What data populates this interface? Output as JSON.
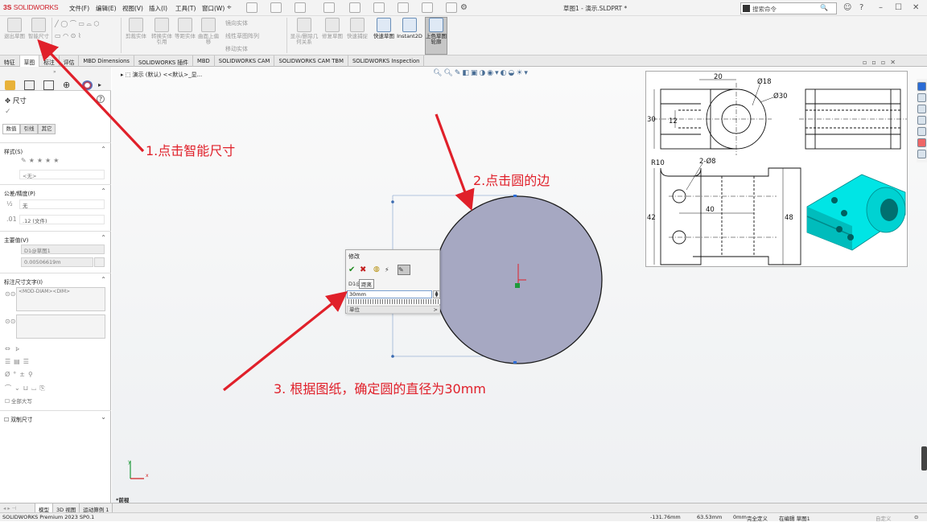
{
  "app": {
    "logo_ds": "3S",
    "logo_name": "SOLIDWORKS",
    "doc_title": "草图1 - 演示.SLDPRT *"
  },
  "menu": [
    "文件(F)",
    "编辑(E)",
    "视图(V)",
    "插入(I)",
    "工具(T)",
    "窗口(W)"
  ],
  "search": {
    "placeholder": "搜索命令"
  },
  "commands": [
    {
      "label": "退出草图",
      "enabled": false
    },
    {
      "label": "智能尺寸",
      "enabled": false
    },
    {
      "label": "剪裁实体",
      "enabled": false
    },
    {
      "label": "转换实体引用",
      "enabled": false
    },
    {
      "label": "等距实体",
      "enabled": false
    },
    {
      "label": "曲面上偏移",
      "enabled": false
    },
    {
      "label": "镜向实体",
      "enabled": false
    },
    {
      "label": "线性草图阵列",
      "enabled": false
    },
    {
      "label": "移动实体",
      "enabled": false
    },
    {
      "label": "显示/删除几何关系",
      "enabled": false
    },
    {
      "label": "修复草图",
      "enabled": false
    },
    {
      "label": "快速捕捉",
      "enabled": false
    },
    {
      "label": "快速草图",
      "enabled": true
    },
    {
      "label": "Instant2D",
      "enabled": true
    },
    {
      "label": "上色草图轮廓",
      "enabled": true
    }
  ],
  "tabs": [
    "特征",
    "草图",
    "标注",
    "评估",
    "MBD Dimensions",
    "SOLIDWORKS 插件",
    "MBD",
    "SOLIDWORKS CAM",
    "SOLIDWORKS CAM TBM",
    "SOLIDWORKS Inspection"
  ],
  "panel": {
    "title": "尺寸",
    "subtabs": [
      "数值",
      "引线",
      "其它"
    ],
    "style_label": "样式(S)",
    "style_value": "<无>",
    "tolerance_label": "公差/精度(P)",
    "tolerance_type": "无",
    "precision": ".12 (文件)",
    "primary_label": "主要值(V)",
    "primary_name": "D1@草图1",
    "primary_value": "0.00506619m",
    "dimtext_label": "标注尺寸文字(I)",
    "dimtext_value": "<MOD-DIAM><DIM>",
    "fullsize_label": "全部大写",
    "dual_label": "双制尺寸"
  },
  "path": "演示 (默认) <<默认>_显...",
  "modify": {
    "title": "修改",
    "name": "D1@",
    "tooltip": "距离",
    "value": "30mm",
    "unit_label": "单位"
  },
  "annotations": [
    {
      "text": "1.点击智能尺寸"
    },
    {
      "text": "2.点击圆的边"
    },
    {
      "text": "3. 根据图纸，确定圆的直径为30mm"
    }
  ],
  "drawing": {
    "dim_20": "20",
    "dim_phi18": "Ø18",
    "dim_phi30": "Ø30",
    "dim_30": "30",
    "dim_12": "12",
    "dim_r10": "R10",
    "dim_2phi8": "2-Ø8",
    "dim_40": "40",
    "dim_42": "42",
    "dim_48": "48"
  },
  "bottom_tabs": [
    "模型",
    "3D 视图",
    "运动算例 1"
  ],
  "preview": "*前视",
  "status": {
    "product": "SOLIDWORKS Premium 2023 SP0.1",
    "x": "-131.76mm",
    "y": "63.53mm",
    "z": "0mm",
    "defined": "完全定义",
    "editing": "在编辑 草图1",
    "custom": "自定义"
  },
  "colors": {
    "accent": "#e0202a",
    "circle": "#a6a8c2",
    "cad": "#00e5e5"
  }
}
